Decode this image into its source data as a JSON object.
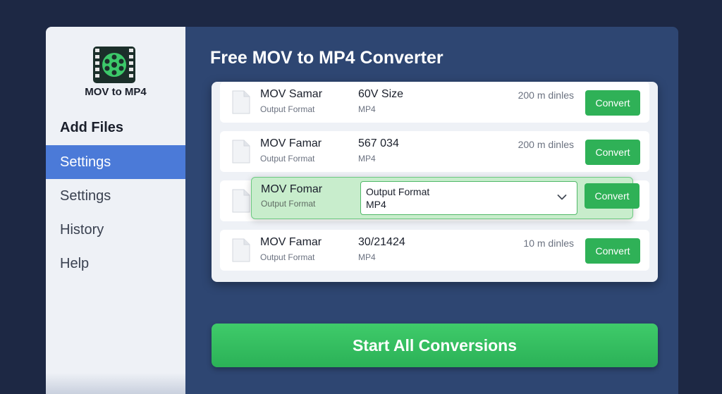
{
  "sidebar": {
    "app_name": "MOV to MP4",
    "logo_icon": "film-reel-icon",
    "items": [
      {
        "label": "Add Files"
      },
      {
        "label": "Settings"
      },
      {
        "label": "Settings"
      },
      {
        "label": "History"
      },
      {
        "label": "Help"
      }
    ]
  },
  "main": {
    "title": "Free MOV to MP4 Converter",
    "files": [
      {
        "name": "MOV Samar",
        "format_label": "Output Format",
        "size": "60V Size",
        "format_value": "MP4",
        "time": "200 m dinles",
        "convert_label": "Convert"
      },
      {
        "name": "MOV Famar",
        "format_label": "Output Format",
        "size": "567 034",
        "format_value": "MP4",
        "time": "200 m dinles",
        "convert_label": "Convert"
      },
      {
        "name": "MOV Fomar",
        "format_label": "Output Format",
        "size": "",
        "format_value": "",
        "time": "",
        "convert_label": "Convert"
      },
      {
        "name": "MOV Famar",
        "format_label": "Output Format",
        "size": "30/21424",
        "format_value": "MP4",
        "time": "10 m dinles",
        "convert_label": "Convert"
      }
    ],
    "dropdown": {
      "label": "Output Format",
      "value": "MP4"
    },
    "start_all_label": "Start All Conversions"
  },
  "colors": {
    "background": "#1d2844",
    "main_panel": "#2e4672",
    "active_nav": "#4b7ad8",
    "accent_green": "#2fb157"
  }
}
